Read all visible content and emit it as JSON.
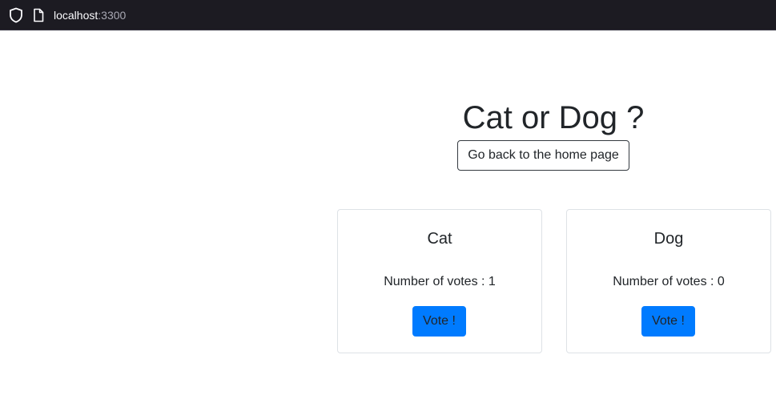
{
  "browser": {
    "host": "localhost",
    "port": ":3300"
  },
  "page": {
    "title": "Cat or Dog ?",
    "home_button_label": "Go back to the home page"
  },
  "cards": [
    {
      "title": "Cat",
      "votes_text": "Number of votes : 1",
      "votes": 1,
      "button_label": "Vote !"
    },
    {
      "title": "Dog",
      "votes_text": "Number of votes : 0",
      "votes": 0,
      "button_label": "Vote !"
    }
  ],
  "colors": {
    "browser_bar": "#1c1b22",
    "vote_button": "#007bff",
    "text": "#212529",
    "card_border": "#dee2e6"
  },
  "icons": [
    "shield-icon",
    "page-icon"
  ]
}
